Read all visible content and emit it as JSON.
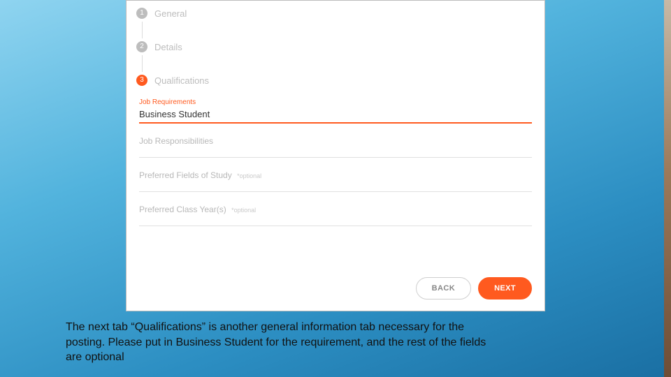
{
  "steps": {
    "s1": {
      "num": "1",
      "label": "General"
    },
    "s2": {
      "num": "2",
      "label": "Details"
    },
    "s3": {
      "num": "3",
      "label": "Qualifications"
    }
  },
  "fields": {
    "requirements": {
      "label": "Job Requirements",
      "value": "Business Student"
    },
    "responsibilities": {
      "label": "Job Responsibilities"
    },
    "fos": {
      "label": "Preferred Fields of Study",
      "optional": "*optional"
    },
    "classyear": {
      "label": "Preferred Class Year(s)",
      "optional": "*optional"
    }
  },
  "buttons": {
    "back": "BACK",
    "next": "NEXT"
  },
  "caption": "The next tab “Qualifications” is another general information tab necessary for the posting. Please put in Business Student for the requirement, and the rest of the fields are optional"
}
